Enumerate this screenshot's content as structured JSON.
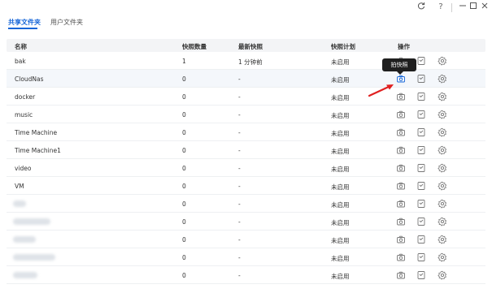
{
  "window": {
    "refresh_icon": "refresh-icon",
    "help_label": "?",
    "minimize_icon": "minimize-icon",
    "maximize_icon": "maximize-icon",
    "close_icon": "close-icon"
  },
  "tabs": [
    {
      "label": "共享文件夹",
      "active": true
    },
    {
      "label": "用户文件夹",
      "active": false
    }
  ],
  "accent_color": "#1565d8",
  "table": {
    "headers": {
      "name": "名称",
      "count": "快照数量",
      "latest": "最新快照",
      "plan": "快照计划",
      "actions": "操作"
    },
    "rows": [
      {
        "name": "bak",
        "count": "1",
        "latest": "1 分钟前",
        "plan": "未启用"
      },
      {
        "name": "CloudNas",
        "count": "0",
        "latest": "-",
        "plan": "未启用"
      },
      {
        "name": "docker",
        "count": "0",
        "latest": "-",
        "plan": "未启用"
      },
      {
        "name": "music",
        "count": "0",
        "latest": "-",
        "plan": "未启用"
      },
      {
        "name": "Time Machine",
        "count": "0",
        "latest": "-",
        "plan": "未启用"
      },
      {
        "name": "Time Machine1",
        "count": "0",
        "latest": "-",
        "plan": "未启用"
      },
      {
        "name": "video",
        "count": "0",
        "latest": "-",
        "plan": "未启用"
      },
      {
        "name": "VM",
        "count": "0",
        "latest": "-",
        "plan": "未启用"
      },
      {
        "name": "",
        "count": "0",
        "latest": "-",
        "plan": "未启用"
      },
      {
        "name": "",
        "count": "0",
        "latest": "-",
        "plan": "未启用"
      },
      {
        "name": "",
        "count": "0",
        "latest": "-",
        "plan": "未启用"
      },
      {
        "name": "",
        "count": "0",
        "latest": "-",
        "plan": "未启用"
      },
      {
        "name": "",
        "count": "0",
        "latest": "-",
        "plan": "未启用"
      }
    ],
    "action_icons": [
      "camera-icon",
      "snapshot-list-icon",
      "settings-icon"
    ]
  },
  "tooltip": {
    "text": "拍快照"
  }
}
